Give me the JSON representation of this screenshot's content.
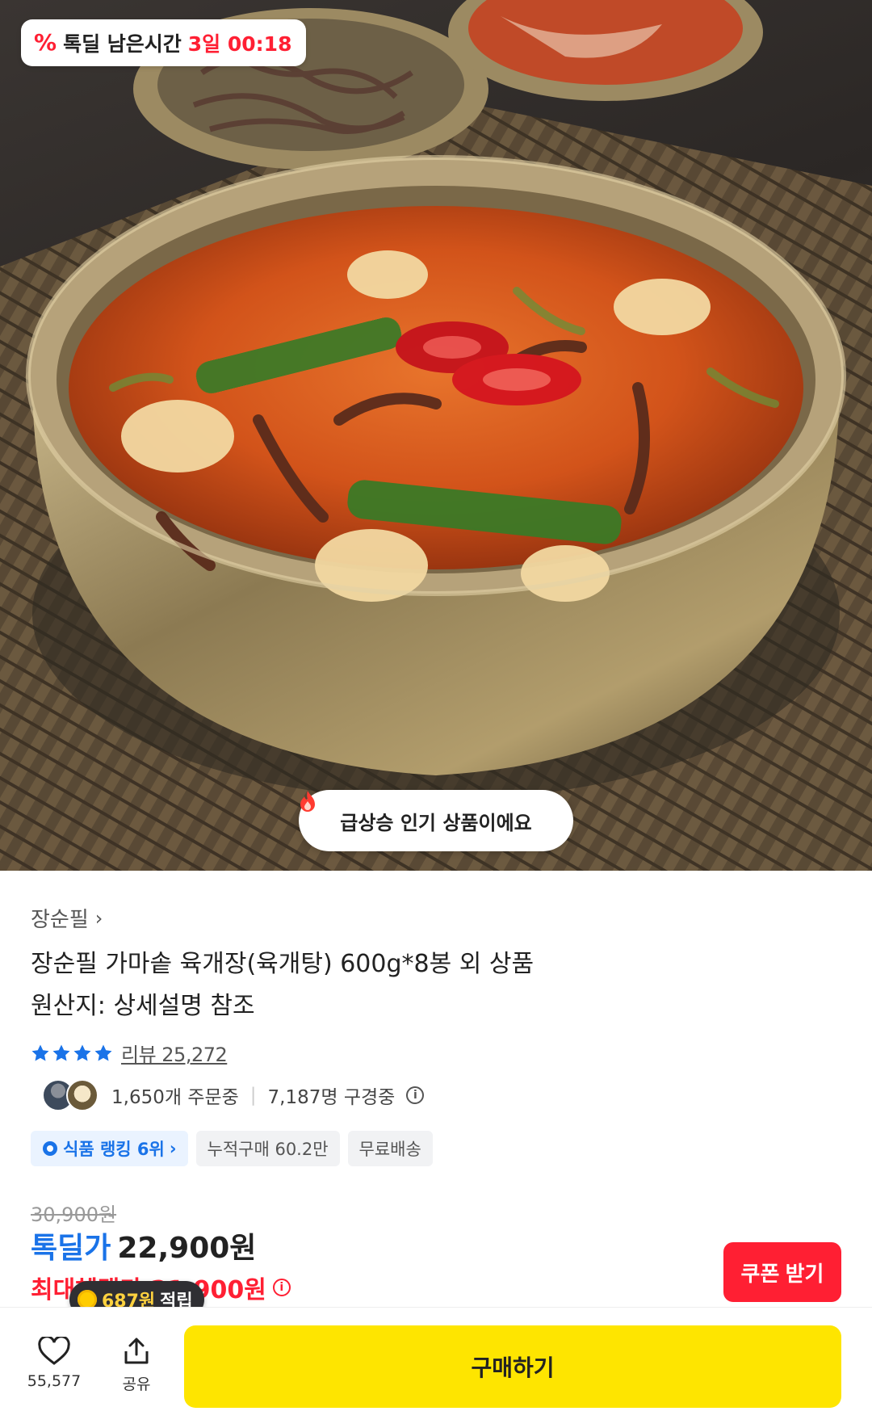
{
  "hero": {
    "deal_badge": {
      "icon": "percent-icon",
      "label": "톡딜 남은시간",
      "time": "3일 00:18"
    },
    "popular_pill": {
      "icon": "fire-icon",
      "label": "급상승 인기 상품이에요"
    }
  },
  "product": {
    "brand": "장순필",
    "title_line1": "장순필 가마솥 육개장(육개탕) 600g*8봉 외 상품",
    "title_line2": "원산지: 상세설명 참조",
    "rating_stars": 4,
    "review_label": "리뷰 25,272",
    "orders_text": "1,650개 주문중",
    "viewers_text": "7,187명 구경중",
    "tags": {
      "rank": "식품 랭킹 6위",
      "cumulative": "누적구매 60.2만",
      "shipping": "무료배송"
    },
    "original_price": "30,900원",
    "deal_label": "톡딜가",
    "deal_price": "22,900원",
    "max_benefit_text": "최대혜택가 21,900원",
    "coupon_button": "쿠폰 받기",
    "point_bubble": {
      "amount": "687원",
      "suffix": "적립"
    }
  },
  "bottom_bar": {
    "like_count": "55,577",
    "share_label": "공유",
    "buy_label": "구매하기"
  },
  "colors": {
    "accent_red": "#ff1f33",
    "accent_blue": "#1a73e8",
    "buy_yellow": "#fee500"
  }
}
